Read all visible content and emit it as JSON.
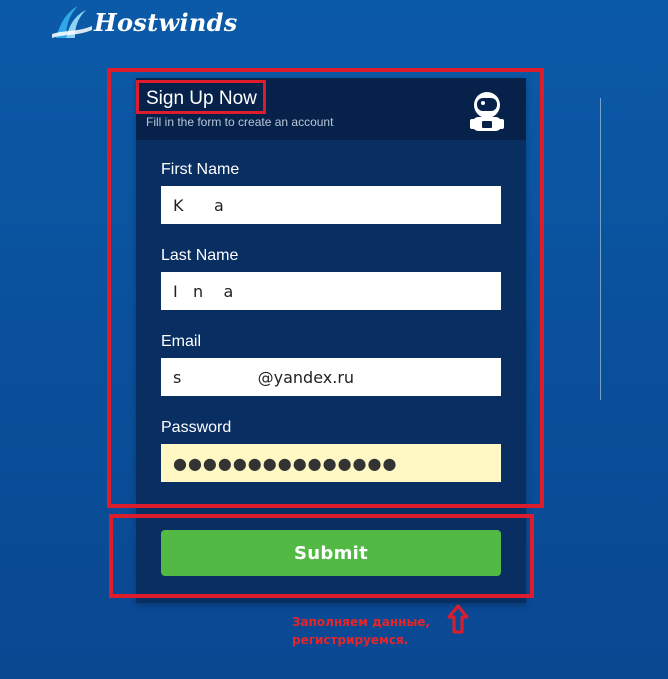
{
  "brand": {
    "name": "Hostwinds"
  },
  "card": {
    "title": "Sign Up Now",
    "subtitle": "Fill in the form to create an account"
  },
  "form": {
    "first_name": {
      "label": "First Name",
      "value": "K      a"
    },
    "last_name": {
      "label": "Last Name",
      "value": "I   n    a"
    },
    "email": {
      "label": "Email",
      "value": "s               @yandex.ru"
    },
    "password": {
      "label": "Password",
      "value": "●●●●●●●●●●●●●●●"
    },
    "submit_label": "Submit"
  },
  "annotation": {
    "line1": "Заполняем данные,",
    "line2": "регистрируемся."
  },
  "colors": {
    "background": "#0b5aa8",
    "card": "#092e62",
    "card_header": "#06224a",
    "submit": "#52b944",
    "password_autofill": "#fff7c4",
    "annotation_red": "#dd1c2c"
  },
  "icons": {
    "logo": "hostwinds-wave-icon",
    "header": "astronaut-icon",
    "annotation_arrow": "up-arrow-icon"
  }
}
